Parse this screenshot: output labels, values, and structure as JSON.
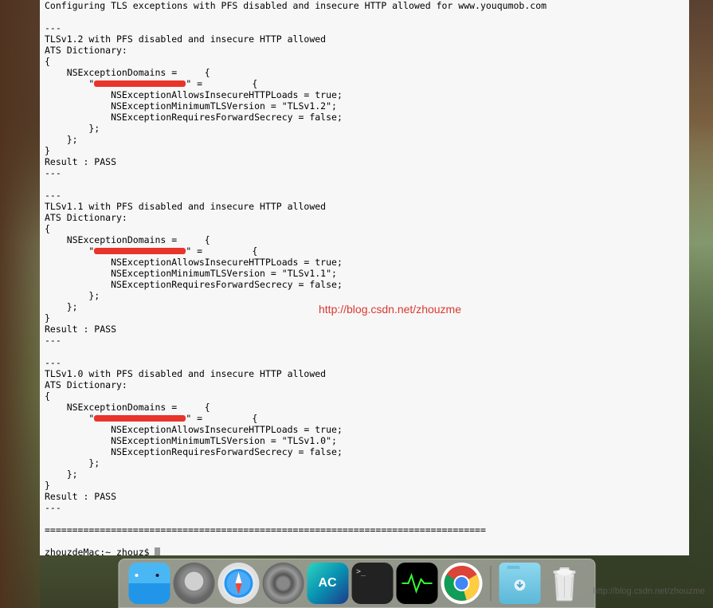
{
  "terminal": {
    "lines": [
      "Configuring TLS exceptions with PFS disabled and insecure HTTP allowed for www.youqumob.com",
      "",
      "---",
      "TLSv1.2 with PFS disabled and insecure HTTP allowed",
      "ATS Dictionary:",
      "{",
      "    NSExceptionDomains =     {",
      "        \"[REDACTED]\" =         {",
      "            NSExceptionAllowsInsecureHTTPLoads = true;",
      "            NSExceptionMinimumTLSVersion = \"TLSv1.2\";",
      "            NSExceptionRequiresForwardSecrecy = false;",
      "        };",
      "    };",
      "}",
      "Result : PASS",
      "---",
      "",
      "---",
      "TLSv1.1 with PFS disabled and insecure HTTP allowed",
      "ATS Dictionary:",
      "{",
      "    NSExceptionDomains =     {",
      "        \"[REDACTED]\" =         {",
      "            NSExceptionAllowsInsecureHTTPLoads = true;",
      "            NSExceptionMinimumTLSVersion = \"TLSv1.1\";",
      "            NSExceptionRequiresForwardSecrecy = false;",
      "        };",
      "    };",
      "}",
      "Result : PASS",
      "---",
      "",
      "---",
      "TLSv1.0 with PFS disabled and insecure HTTP allowed",
      "ATS Dictionary:",
      "{",
      "    NSExceptionDomains =     {",
      "        \"[REDACTED]\" =         {",
      "            NSExceptionAllowsInsecureHTTPLoads = true;",
      "            NSExceptionMinimumTLSVersion = \"TLSv1.0\";",
      "            NSExceptionRequiresForwardSecrecy = false;",
      "        };",
      "    };",
      "}",
      "Result : PASS",
      "---",
      "",
      "================================================================================",
      "",
      "zhouzdeMac:~ zhouz$ "
    ],
    "prompt_host": "zhouzdeMac",
    "prompt_user": "zhouz",
    "prompt_dir": "~"
  },
  "watermark": {
    "url": "http://blog.csdn.net/zhouzme"
  },
  "dock": {
    "items": [
      {
        "id": "finder",
        "name": "Finder"
      },
      {
        "id": "launchpad",
        "name": "Launchpad"
      },
      {
        "id": "safari",
        "name": "Safari"
      },
      {
        "id": "settings",
        "name": "System Preferences"
      },
      {
        "id": "appcode",
        "name": "AppCode",
        "label": "AC"
      },
      {
        "id": "terminal",
        "name": "Terminal",
        "label": ">_"
      },
      {
        "id": "activity",
        "name": "Activity Monitor"
      },
      {
        "id": "chrome",
        "name": "Google Chrome"
      }
    ],
    "right_items": [
      {
        "id": "downloads",
        "name": "Downloads"
      },
      {
        "id": "trash",
        "name": "Trash"
      }
    ]
  }
}
